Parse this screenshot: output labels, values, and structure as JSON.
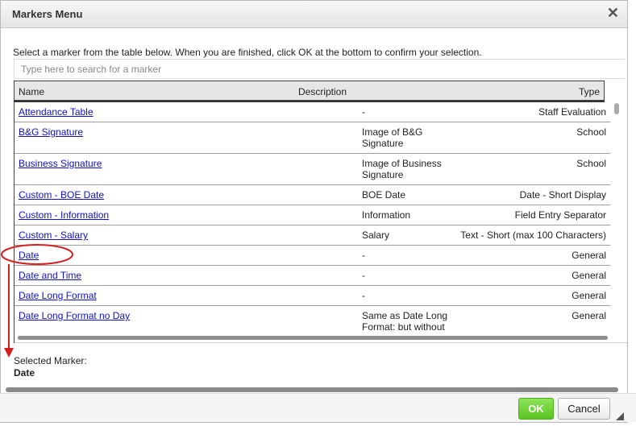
{
  "window": {
    "title": "Markers Menu"
  },
  "instructions": "Select a marker from the table below. When you are finished, click OK at the bottom to confirm your selection.",
  "search": {
    "placeholder": "Type here to search for a marker"
  },
  "table": {
    "columns": {
      "name": "Name",
      "description": "Description",
      "type": "Type"
    },
    "rows": [
      {
        "name": "Attendance Table",
        "description": "-",
        "type": "Staff Evaluation"
      },
      {
        "name": "B&G Signature",
        "description": "Image of B&G Signature",
        "type": "School"
      },
      {
        "name": "Business Signature",
        "description": "Image of Business Signature",
        "type": "School"
      },
      {
        "name": "Custom - BOE Date",
        "description": "BOE Date",
        "type": "Date - Short Display"
      },
      {
        "name": "Custom - Information",
        "description": "Information",
        "type": "Field Entry Separator"
      },
      {
        "name": "Custom - Salary",
        "description": "Salary",
        "type": "Text - Short (max 100 Characters)"
      },
      {
        "name": "Date",
        "description": "-",
        "type": "General"
      },
      {
        "name": "Date and Time",
        "description": "-",
        "type": "General"
      },
      {
        "name": "Date Long Format",
        "description": "-",
        "type": "General"
      },
      {
        "name": "Date Long Format no Day",
        "description": "Same as Date Long Format: but without",
        "type": "General"
      }
    ]
  },
  "selected": {
    "label": "Selected Marker:",
    "value": "Date"
  },
  "buttons": {
    "ok": "OK",
    "cancel": "Cancel"
  },
  "icons": {
    "close": "close-icon",
    "resize": "resize-grip-icon"
  },
  "colors": {
    "link": "#1010cc",
    "ok_button": "#58c51e",
    "annotation": "#d42020"
  }
}
